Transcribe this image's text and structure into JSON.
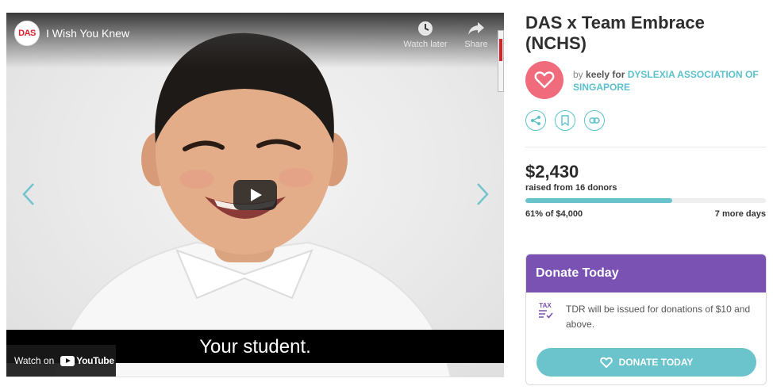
{
  "video": {
    "channel_logo_text": "DAS",
    "title": "I Wish You Knew",
    "watch_later_label": "Watch later",
    "share_label": "Share",
    "subtitle": "Your student.",
    "watch_on_label": "Watch on",
    "youtube_label": "YouTube"
  },
  "campaign": {
    "title": "DAS x Team Embrace (NCHS)",
    "by_prefix": "by",
    "user": "keely",
    "for_word": "for",
    "organization": "DYSLEXIA ASSOCIATION OF SINGAPORE"
  },
  "stats": {
    "raised": "$2,430",
    "donors_text": "raised from 16 donors",
    "progress_fraction": 0.61,
    "percent_text": "61% of $4,000",
    "days_left": "7 more days"
  },
  "donate": {
    "header": "Donate Today",
    "tax_icon_label": "TAX",
    "tax_text": "TDR will be issued for donations of $10 and above.",
    "button_label": "DONATE TODAY"
  },
  "colors": {
    "accent_teal": "#67c3cc",
    "accent_purple": "#7a52b3",
    "avatar_pink": "#f06b7b"
  },
  "icons": [
    "clock-icon",
    "share-arrow-icon",
    "chevron-left-icon",
    "chevron-right-icon",
    "play-icon",
    "heart-icon",
    "share-icon",
    "bookmark-icon",
    "link-icon",
    "tax-checklist-icon"
  ]
}
